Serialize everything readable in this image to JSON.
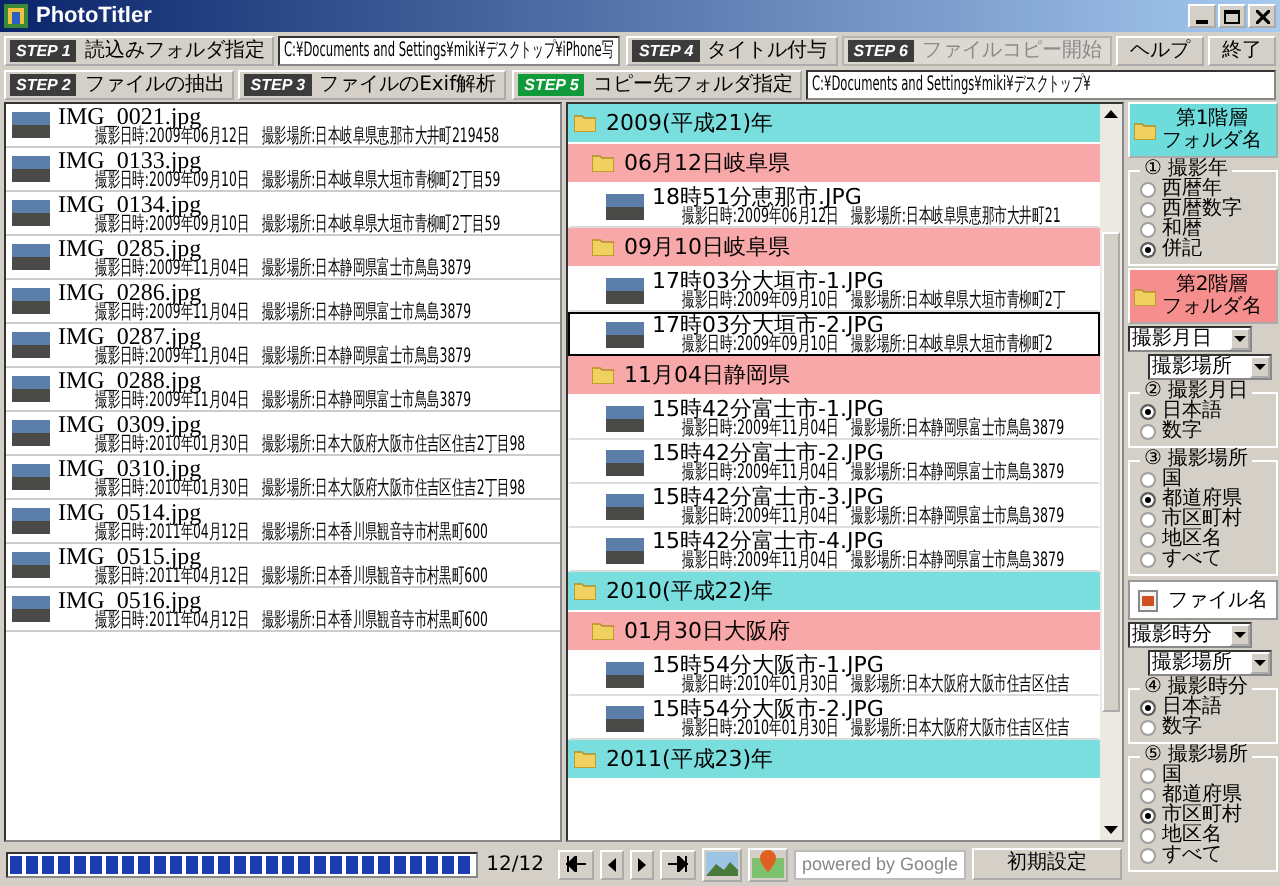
{
  "window": {
    "title": "PhotoTitler"
  },
  "toolbar": {
    "rows": [
      {
        "left": [
          {
            "kind": "step",
            "step": "STEP 1",
            "label": "読込みフォルダ指定",
            "active": false,
            "disabled": false
          },
          {
            "kind": "path",
            "value": "C:¥Documents and Settings¥miki¥デスクトップ¥iPhone写"
          }
        ],
        "right": [
          {
            "kind": "step",
            "step": "STEP 4",
            "label": "タイトル付与",
            "active": false,
            "disabled": false
          },
          {
            "kind": "step",
            "step": "STEP 6",
            "label": "ファイルコピー開始",
            "active": false,
            "disabled": true
          },
          {
            "kind": "plain",
            "label": "ヘルプ",
            "disabled": false
          },
          {
            "kind": "plain",
            "label": "終了",
            "disabled": false
          }
        ]
      },
      {
        "left": [
          {
            "kind": "step",
            "step": "STEP 2",
            "label": "ファイルの抽出",
            "active": false,
            "disabled": false
          },
          {
            "kind": "step",
            "step": "STEP 3",
            "label": "ファイルのExif解析",
            "active": false,
            "disabled": false
          }
        ],
        "right": [
          {
            "kind": "step",
            "step": "STEP 5",
            "label": "コピー先フォルダ指定",
            "active": true,
            "disabled": false
          },
          {
            "kind": "path",
            "value": "C:¥Documents and Settings¥miki¥デスクトップ¥"
          }
        ]
      }
    ]
  },
  "files": [
    {
      "name": "IMG_0021.jpg",
      "date": "撮影日時:2009年06月12日",
      "location": "撮影場所:日本岐阜県恵那市大井町219458"
    },
    {
      "name": "IMG_0133.jpg",
      "date": "撮影日時:2009年09月10日",
      "location": "撮影場所:日本岐阜県大垣市青柳町2丁目59"
    },
    {
      "name": "IMG_0134.jpg",
      "date": "撮影日時:2009年09月10日",
      "location": "撮影場所:日本岐阜県大垣市青柳町2丁目59"
    },
    {
      "name": "IMG_0285.jpg",
      "date": "撮影日時:2009年11月04日",
      "location": "撮影場所:日本静岡県富士市鳥島3879"
    },
    {
      "name": "IMG_0286.jpg",
      "date": "撮影日時:2009年11月04日",
      "location": "撮影場所:日本静岡県富士市鳥島3879"
    },
    {
      "name": "IMG_0287.jpg",
      "date": "撮影日時:2009年11月04日",
      "location": "撮影場所:日本静岡県富士市鳥島3879"
    },
    {
      "name": "IMG_0288.jpg",
      "date": "撮影日時:2009年11月04日",
      "location": "撮影場所:日本静岡県富士市鳥島3879"
    },
    {
      "name": "IMG_0309.jpg",
      "date": "撮影日時:2010年01月30日",
      "location": "撮影場所:日本大阪府大阪市住吉区住吉2丁目98"
    },
    {
      "name": "IMG_0310.jpg",
      "date": "撮影日時:2010年01月30日",
      "location": "撮影場所:日本大阪府大阪市住吉区住吉2丁目98"
    },
    {
      "name": "IMG_0514.jpg",
      "date": "撮影日時:2011年04月12日",
      "location": "撮影場所:日本香川県観音寺市村黒町600"
    },
    {
      "name": "IMG_0515.jpg",
      "date": "撮影日時:2011年04月12日",
      "location": "撮影場所:日本香川県観音寺市村黒町600"
    },
    {
      "name": "IMG_0516.jpg",
      "date": "撮影日時:2011年04月12日",
      "location": "撮影場所:日本香川県観音寺市村黒町600"
    }
  ],
  "tree": [
    {
      "label": "2009(平成21)年",
      "children": [
        {
          "label": "06月12日岐阜県",
          "children": [
            {
              "name": "18時51分恵那市.JPG",
              "date": "撮影日時:2009年06月12日",
              "location": "撮影場所:日本岐阜県恵那市大井町21",
              "selected": false
            }
          ]
        },
        {
          "label": "09月10日岐阜県",
          "children": [
            {
              "name": "17時03分大垣市-1.JPG",
              "date": "撮影日時:2009年09月10日",
              "location": "撮影場所:日本岐阜県大垣市青柳町2丁",
              "selected": false
            },
            {
              "name": "17時03分大垣市-2.JPG",
              "date": "撮影日時:2009年09月10日",
              "location": "撮影場所:日本岐阜県大垣市青柳町2",
              "selected": true
            }
          ]
        },
        {
          "label": "11月04日静岡県",
          "children": [
            {
              "name": "15時42分富士市-1.JPG",
              "date": "撮影日時:2009年11月04日",
              "location": "撮影場所:日本静岡県富士市鳥島3879",
              "selected": false
            },
            {
              "name": "15時42分富士市-2.JPG",
              "date": "撮影日時:2009年11月04日",
              "location": "撮影場所:日本静岡県富士市鳥島3879",
              "selected": false
            },
            {
              "name": "15時42分富士市-3.JPG",
              "date": "撮影日時:2009年11月04日",
              "location": "撮影場所:日本静岡県富士市鳥島3879",
              "selected": false
            },
            {
              "name": "15時42分富士市-4.JPG",
              "date": "撮影日時:2009年11月04日",
              "location": "撮影場所:日本静岡県富士市鳥島3879",
              "selected": false
            }
          ]
        }
      ]
    },
    {
      "label": "2010(平成22)年",
      "children": [
        {
          "label": "01月30日大阪府",
          "children": [
            {
              "name": "15時54分大阪市-1.JPG",
              "date": "撮影日時:2010年01月30日",
              "location": "撮影場所:日本大阪府大阪市住吉区住吉",
              "selected": false
            },
            {
              "name": "15時54分大阪市-2.JPG",
              "date": "撮影日時:2010年01月30日",
              "location": "撮影場所:日本大阪府大阪市住吉区住吉",
              "selected": false
            }
          ]
        }
      ]
    },
    {
      "label": "2011(平成23)年"
    }
  ],
  "panel": {
    "items": [
      {
        "kind": "level_button",
        "lines": [
          "第1階層",
          "フォルダ名"
        ],
        "color": "#6fdcdc"
      },
      {
        "kind": "radio_group",
        "title": "① 撮影年",
        "options": [
          {
            "label": "西暦年",
            "selected": false
          },
          {
            "label": "西暦数字",
            "selected": false
          },
          {
            "label": "和暦",
            "selected": false
          },
          {
            "label": "併記",
            "selected": true
          }
        ]
      },
      {
        "kind": "level_button",
        "lines": [
          "第2階層",
          "フォルダ名"
        ],
        "color": "#f78e8e"
      },
      {
        "kind": "dropdown_pair",
        "values": [
          "撮影月日",
          "撮影場所"
        ]
      },
      {
        "kind": "radio_group",
        "title": "② 撮影月日",
        "options": [
          {
            "label": "日本語",
            "selected": true
          },
          {
            "label": "数字",
            "selected": false
          }
        ]
      },
      {
        "kind": "radio_group",
        "title": "③ 撮影場所",
        "options": [
          {
            "label": "国",
            "selected": false
          },
          {
            "label": "都道府県",
            "selected": true
          },
          {
            "label": "市区町村",
            "selected": false
          },
          {
            "label": "地区名",
            "selected": false
          },
          {
            "label": "すべて",
            "selected": false
          }
        ]
      },
      {
        "kind": "file_button",
        "label": "ファイル名"
      },
      {
        "kind": "dropdown_pair",
        "values": [
          "撮影時分",
          "撮影場所"
        ]
      },
      {
        "kind": "radio_group",
        "title": "④ 撮影時分",
        "options": [
          {
            "label": "日本語",
            "selected": true
          },
          {
            "label": "数字",
            "selected": false
          }
        ]
      },
      {
        "kind": "radio_group",
        "title": "⑤ 撮影場所",
        "options": [
          {
            "label": "国",
            "selected": false
          },
          {
            "label": "都道府県",
            "selected": false
          },
          {
            "label": "市区町村",
            "selected": true
          },
          {
            "label": "地区名",
            "selected": false
          },
          {
            "label": "すべて",
            "selected": false
          }
        ]
      }
    ]
  },
  "status_bar": {
    "progress": {
      "level": 1
    },
    "counter": "12/12",
    "attribution": "powered by Google",
    "reset_button": "初期設定"
  }
}
